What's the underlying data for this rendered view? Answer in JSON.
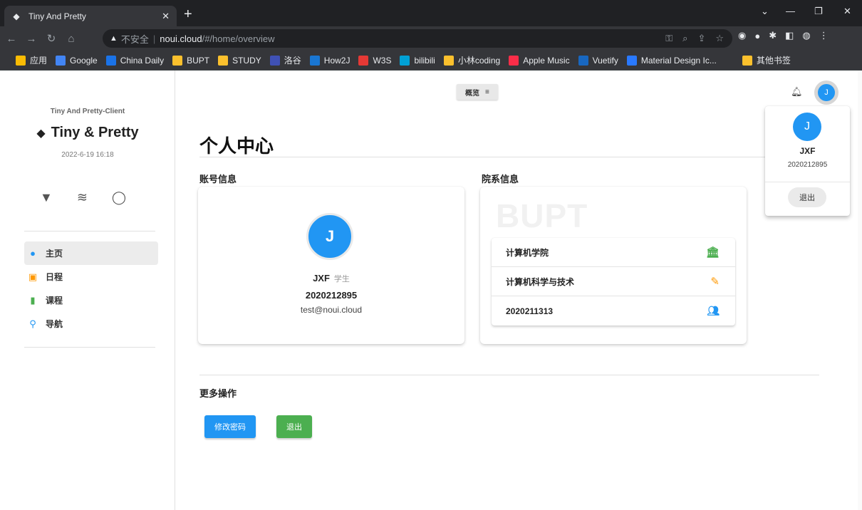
{
  "browser": {
    "tab_title": "Tiny And Pretty",
    "url_warning": "不安全",
    "url_host": "noui.cloud",
    "url_path": "/#/home/overview",
    "bookmarks": [
      {
        "label": "应用",
        "color": "#fbbc04"
      },
      {
        "label": "Google",
        "color": "#4285f4"
      },
      {
        "label": "China Daily",
        "color": "#1a73e8"
      },
      {
        "label": "BUPT",
        "color": "#fbc02d"
      },
      {
        "label": "STUDY",
        "color": "#fbc02d"
      },
      {
        "label": "洛谷",
        "color": "#3f51b5"
      },
      {
        "label": "How2J",
        "color": "#1976d2"
      },
      {
        "label": "W3S",
        "color": "#e53935"
      },
      {
        "label": "bilibili",
        "color": "#00a1d6"
      },
      {
        "label": "小林coding",
        "color": "#fbc02d"
      },
      {
        "label": "Apple Music",
        "color": "#fa2d48"
      },
      {
        "label": "Vuetify",
        "color": "#1867c0"
      },
      {
        "label": "Material Design Ic...",
        "color": "#2979ff"
      },
      {
        "label": "其他书签",
        "color": "#fbc02d"
      }
    ]
  },
  "sidebar": {
    "app_name": "Tiny And Pretty-Client",
    "brand": "Tiny & Pretty",
    "datetime": "2022-6-19 16:18",
    "nav": [
      {
        "label": "主页",
        "icon": "account-circle-icon",
        "color": "#2196f3"
      },
      {
        "label": "日程",
        "icon": "calendar-icon",
        "color": "#ff9800"
      },
      {
        "label": "课程",
        "icon": "book-icon",
        "color": "#4caf50"
      },
      {
        "label": "导航",
        "icon": "map-marker-icon",
        "color": "#2196f3"
      }
    ]
  },
  "header": {
    "breadcrumb": "概览",
    "avatar_letter": "J"
  },
  "page": {
    "title": "个人中心",
    "account_section": "账号信息",
    "dept_section": "院系信息",
    "account": {
      "avatar_letter": "J",
      "name": "JXF",
      "role": "学生",
      "id": "2020212895",
      "email": "test@noui.cloud"
    },
    "dept": {
      "watermark": "BUPT",
      "rows": [
        {
          "label": "计算机学院",
          "icon": "bank-icon",
          "color": "#4caf50"
        },
        {
          "label": "计算机科学与技术",
          "icon": "pencil-icon",
          "color": "#ff9800"
        },
        {
          "label": "2020211313",
          "icon": "account-group-icon",
          "color": "#2196f3"
        }
      ]
    },
    "more_section": "更多操作",
    "change_password": "修改密码",
    "logout": "退出"
  },
  "user_menu": {
    "avatar_letter": "J",
    "name": "JXF",
    "id": "2020212895",
    "logout": "退出"
  }
}
